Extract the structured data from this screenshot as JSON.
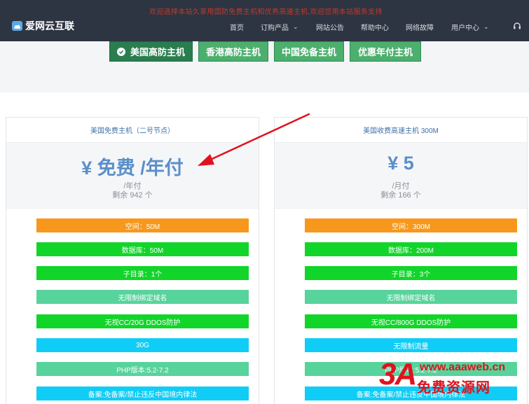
{
  "topbar": {
    "marquee": "欢迎选择本站久享用国防免费主机和优秀高速主机,欢迎您用本站服务支持",
    "brand": "爱网云互联",
    "nav": [
      {
        "label": "首页",
        "has_dropdown": false
      },
      {
        "label": "订购产品",
        "has_dropdown": true
      },
      {
        "label": "网站公告",
        "has_dropdown": false
      },
      {
        "label": "帮助中心",
        "has_dropdown": false
      },
      {
        "label": "网络故障",
        "has_dropdown": false
      },
      {
        "label": "用户中心",
        "has_dropdown": true
      }
    ]
  },
  "tabs": [
    {
      "label": "美国高防主机",
      "active": true
    },
    {
      "label": "香港高防主机",
      "active": false
    },
    {
      "label": "中国免备主机",
      "active": false
    },
    {
      "label": "优惠年付主机",
      "active": false
    }
  ],
  "plans": [
    {
      "title": "美国免费主机（二号节点）",
      "price": "¥ 免费 /年付",
      "unit": "/年付",
      "stock": "剩余 942 个",
      "features": [
        {
          "text": "空间：50M",
          "color": "#f7981c"
        },
        {
          "text": "数据库：50M",
          "color": "#12d52a"
        },
        {
          "text": "子目录：1个",
          "color": "#12d52a"
        },
        {
          "text": "无限制绑定域名",
          "color": "#57d39c"
        },
        {
          "text": "无视CC/20G DDOS防护",
          "color": "#12d52a"
        },
        {
          "text": "30G",
          "color": "#0fcdf6"
        },
        {
          "text": "PHP版本:5.2-7.2",
          "color": "#57d39c"
        },
        {
          "text": "备案:免备案/禁止违反中国境内律法",
          "color": "#0fcdf6"
        }
      ]
    },
    {
      "title": "美国收费高速主机 300M",
      "price": "¥ 5",
      "unit": "/月付",
      "stock": "剩余 166 个",
      "features": [
        {
          "text": "空间：300M",
          "color": "#f7981c"
        },
        {
          "text": "数据库：200M",
          "color": "#12d52a"
        },
        {
          "text": "子目录：3个",
          "color": "#12d52a"
        },
        {
          "text": "无限制绑定域名",
          "color": "#57d39c"
        },
        {
          "text": "无视CC/800G DDOS防护",
          "color": "#12d52a"
        },
        {
          "text": "无限制流量",
          "color": "#0fcdf6"
        },
        {
          "text": "PHP版本:5.2-7.2",
          "color": "#57d39c"
        },
        {
          "text": "备案:免备案/禁止违反中国境内律法",
          "color": "#0fcdf6"
        }
      ]
    }
  ],
  "watermark": {
    "mark": "3A",
    "url": "www.aaaweb.cn",
    "text": "免费资源网"
  },
  "colors": {
    "navbar": "#2d3542",
    "tab": "#4caf6d",
    "tab_active": "#2a7d4f",
    "price": "#5b8fc9",
    "arrow": "#e0121d"
  },
  "icons": [
    "cloud-logo-icon",
    "check-circle-icon",
    "chevron-down-icon",
    "headset-icon",
    "arrow-annotation"
  ]
}
